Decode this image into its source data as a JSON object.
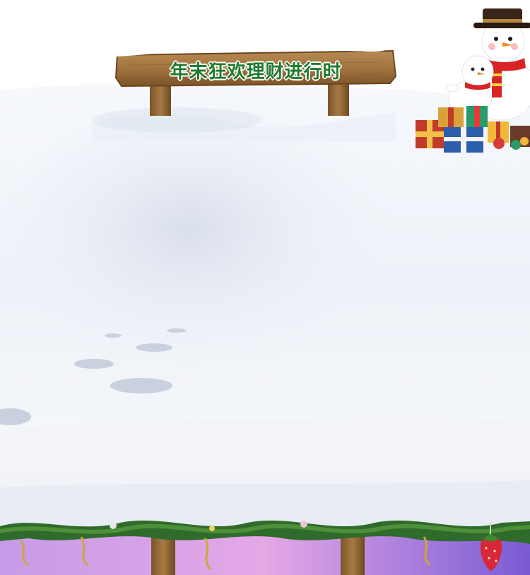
{
  "banner": {
    "sign_text": "年末狂欢理财进行时"
  },
  "colors": {
    "sign_text": "#1f7a2e",
    "sign_wood": "#a0743f",
    "snow": "#f3f6fb",
    "snow_shadow": "#d9e0ec",
    "garland": "#2f6b2a",
    "bottom_gradient_left": "#c79be8",
    "bottom_gradient_right": "#7a5bd4"
  },
  "icons": {
    "snowman_large": "snowman-with-top-hat",
    "snowman_small": "snowman-child",
    "gifts": "gift-boxes",
    "footprints": "snow-footprints",
    "garland": "pine-garland",
    "ornament": "strawberry-ornament"
  }
}
